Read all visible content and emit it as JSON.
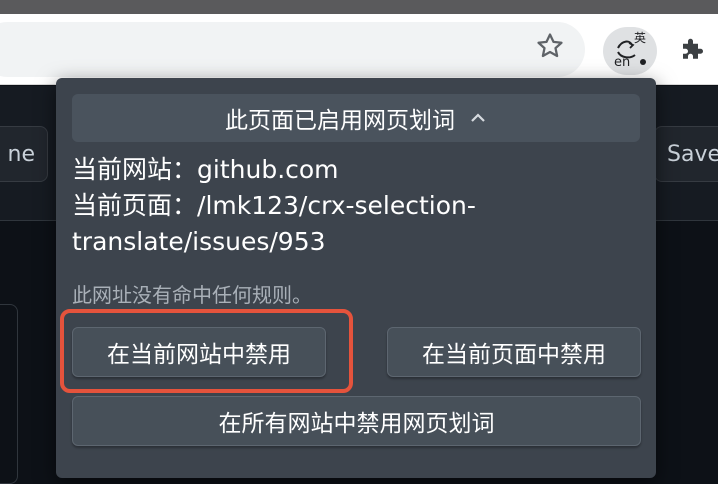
{
  "colors": {
    "highlight": "#e5533c",
    "popup_bg": "#3d444d"
  },
  "toolbar": {
    "bookmark_icon": "star-icon",
    "extension_icon": "translate-icon",
    "extension_logo_top": "英",
    "extension_logo_bottom": "en",
    "extensions_menu_icon": "puzzle-icon"
  },
  "page": {
    "left_button": "ne",
    "right_button": "Save"
  },
  "popup": {
    "header": "此页面已启用网页划词",
    "header_icon": "chevron-up-icon",
    "current_site_label": "当前网站：",
    "current_site": "github.com",
    "current_page_label": "当前页面：",
    "current_page_line1": "/lmk123/crx-selection-",
    "current_page_line2": "translate/issues/953",
    "no_rule_text": "此网址没有命中任何规则。",
    "disable_site": "在当前网站中禁用",
    "disable_page": "在当前页面中禁用",
    "disable_all": "在所有网站中禁用网页划词"
  }
}
